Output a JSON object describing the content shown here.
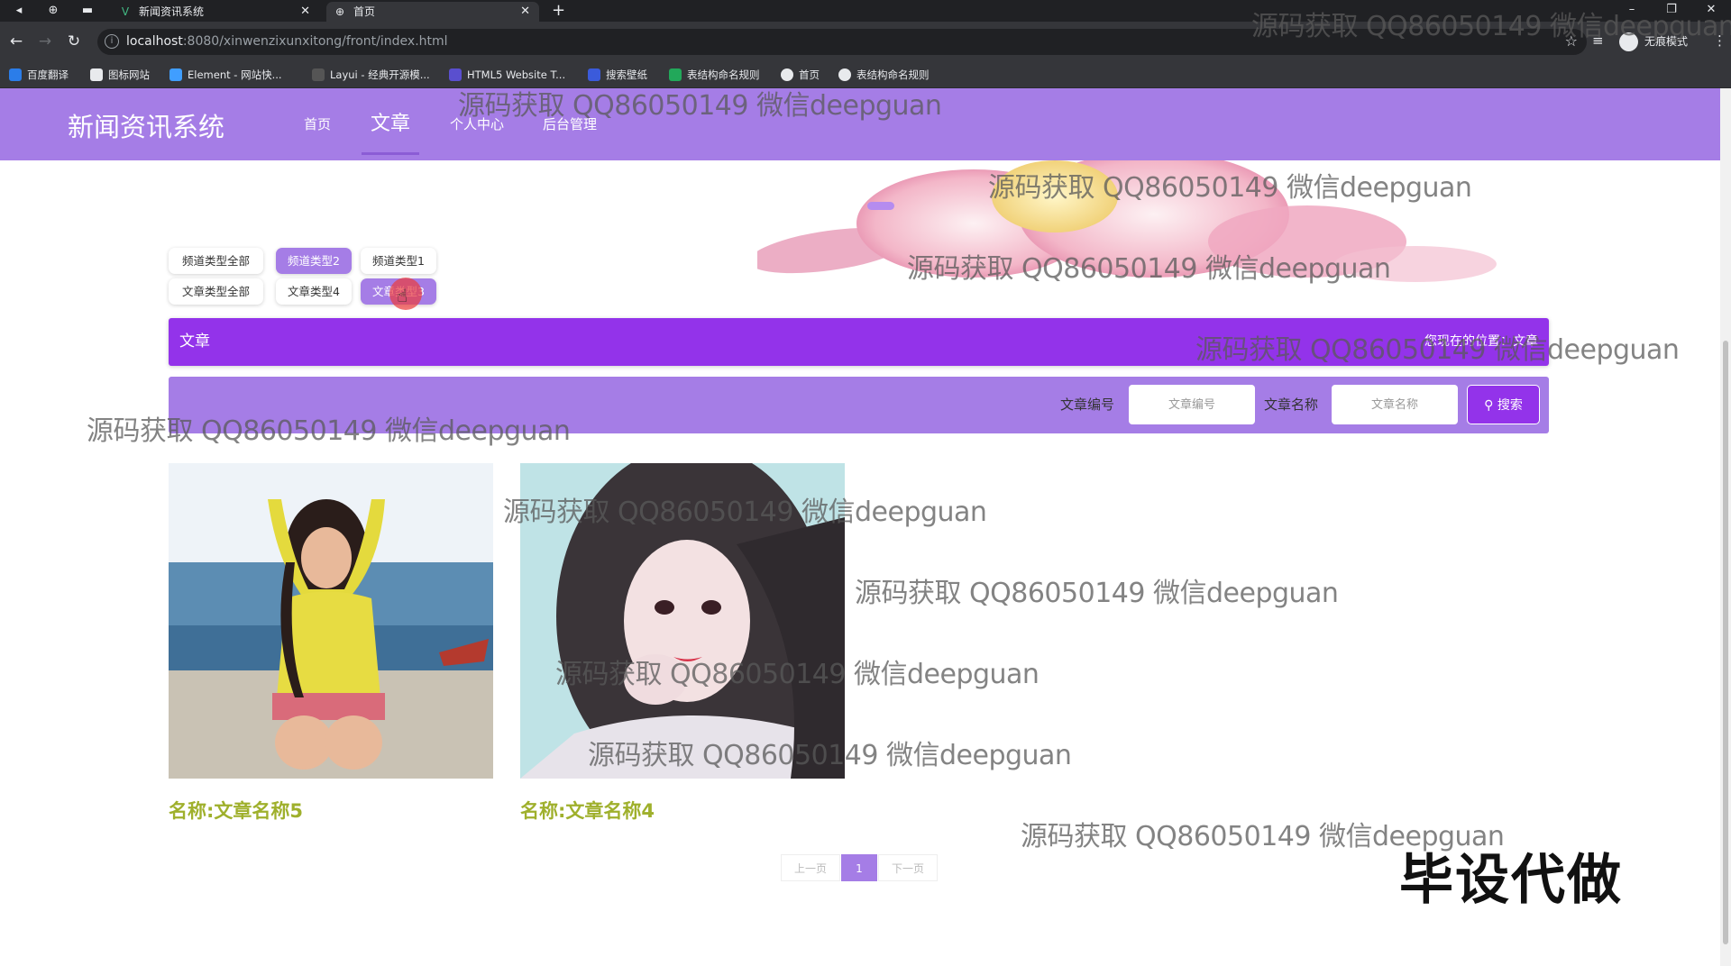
{
  "browser": {
    "tabs": [
      {
        "title": "新闻资讯系统",
        "active": false
      },
      {
        "title": "首页",
        "active": true
      }
    ],
    "url_host": "localhost",
    "url_rest": ":8080/xinwenzixunxitong/front/index.html",
    "profile_label": "无痕模式",
    "bookmarks": [
      "百度翻译",
      "图标网站",
      "Element - 网站快...",
      "Layui - 经典开源模...",
      "HTML5 Website T...",
      "搜索壁纸",
      "表结构命名规则",
      "首页",
      "表结构命名规则"
    ]
  },
  "site": {
    "logo": "新闻资讯系统",
    "nav": [
      "首页",
      "文章",
      "个人中心",
      "后台管理"
    ],
    "active_nav": "文章"
  },
  "filters": {
    "channel": [
      "频道类型全部",
      "频道类型2",
      "频道类型1"
    ],
    "article": [
      "文章类型全部",
      "文章类型4",
      "文章类型3"
    ]
  },
  "section": {
    "title": "文章",
    "breadcrumb": "您现在的位置：文章"
  },
  "search": {
    "label_id": "文章编号",
    "placeholder_id": "文章编号",
    "label_name": "文章名称",
    "placeholder_name": "文章名称",
    "button": "搜索"
  },
  "articles": [
    {
      "name": "名称:文章名称5"
    },
    {
      "name": "名称:文章名称4"
    }
  ],
  "pagination": {
    "prev": "上一页",
    "current": "1",
    "next": "下一页"
  },
  "watermark": "源码获取 QQ86050149 微信deepguan",
  "big_watermark": "毕设代做",
  "colors": {
    "header": "#a57de6",
    "title_bar": "#9333ea",
    "name_text": "#9fb02c"
  }
}
